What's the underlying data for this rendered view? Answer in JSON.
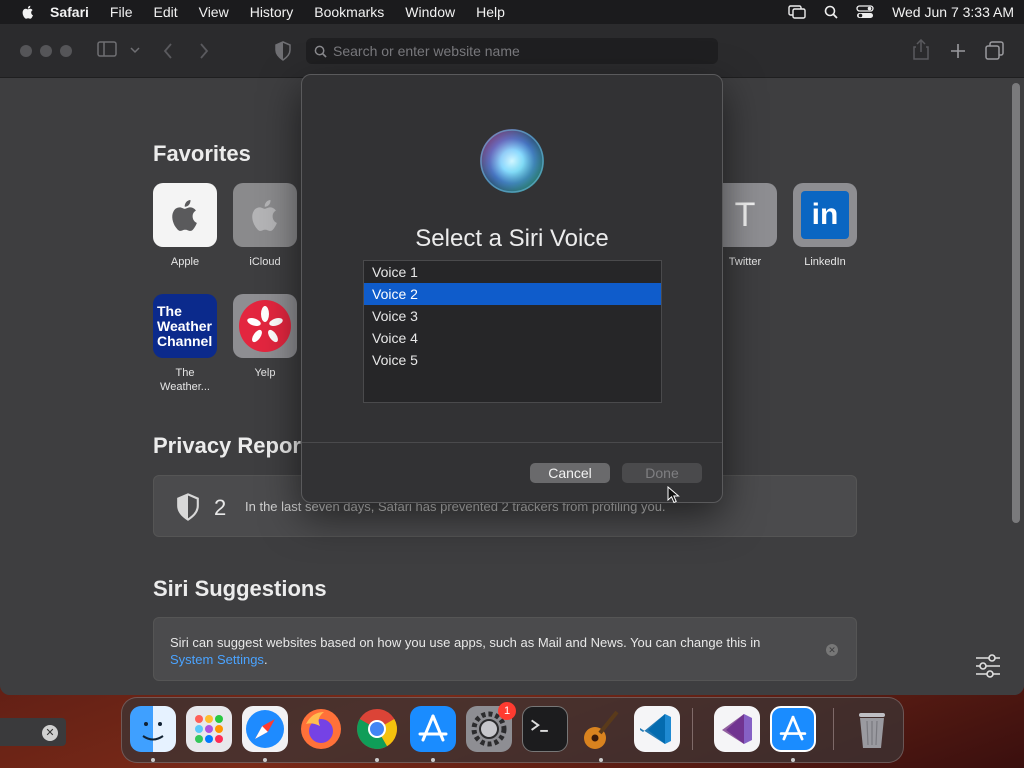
{
  "menubar": {
    "app_name": "Safari",
    "items": [
      "File",
      "Edit",
      "View",
      "History",
      "Bookmarks",
      "Window",
      "Help"
    ],
    "clock": "Wed Jun 7  3:33 AM"
  },
  "toolbar": {
    "search_placeholder": "Search or enter website name"
  },
  "start_page": {
    "favorites_title": "Favorites",
    "favorites": [
      {
        "label": "Apple"
      },
      {
        "label": "iCloud"
      },
      {
        "label": "Twitter",
        "letter": "T"
      },
      {
        "label": "LinkedIn",
        "letter": "in"
      },
      {
        "label": "The Weather...",
        "label_line1": "The",
        "label_line2": "Weather...",
        "tile_text": [
          "The",
          "Weather",
          "Channel"
        ]
      },
      {
        "label": "Yelp"
      }
    ],
    "privacy_title": "Privacy Report",
    "privacy_count": "2",
    "privacy_text": "In the last seven days, Safari has prevented 2 trackers from profiling you.",
    "siri_title": "Siri Suggestions",
    "siri_text": "Siri can suggest websites based on how you use apps, such as Mail and News. You can change this in",
    "siri_link": "System Settings",
    "siri_period": "."
  },
  "dialog": {
    "title": "Select a Siri Voice",
    "voices": [
      "Voice 1",
      "Voice 2",
      "Voice 3",
      "Voice 4",
      "Voice 5"
    ],
    "selected_index": 1,
    "cancel_label": "Cancel",
    "done_label": "Done"
  },
  "dock": {
    "apps": [
      "finder-icon",
      "launchpad-icon",
      "safari-icon",
      "firefox-icon",
      "chrome-icon",
      "app-store-icon",
      "system-settings-icon",
      "terminal-icon",
      "garageband-icon",
      "vscode-icon",
      "visual-studio-icon",
      "xcode-app-store-icon",
      "trash-icon"
    ],
    "settings_badge": "1"
  },
  "colors": {
    "accent": "#0f5ccb",
    "link": "#4aa3ff",
    "badge": "#ff3b30"
  }
}
